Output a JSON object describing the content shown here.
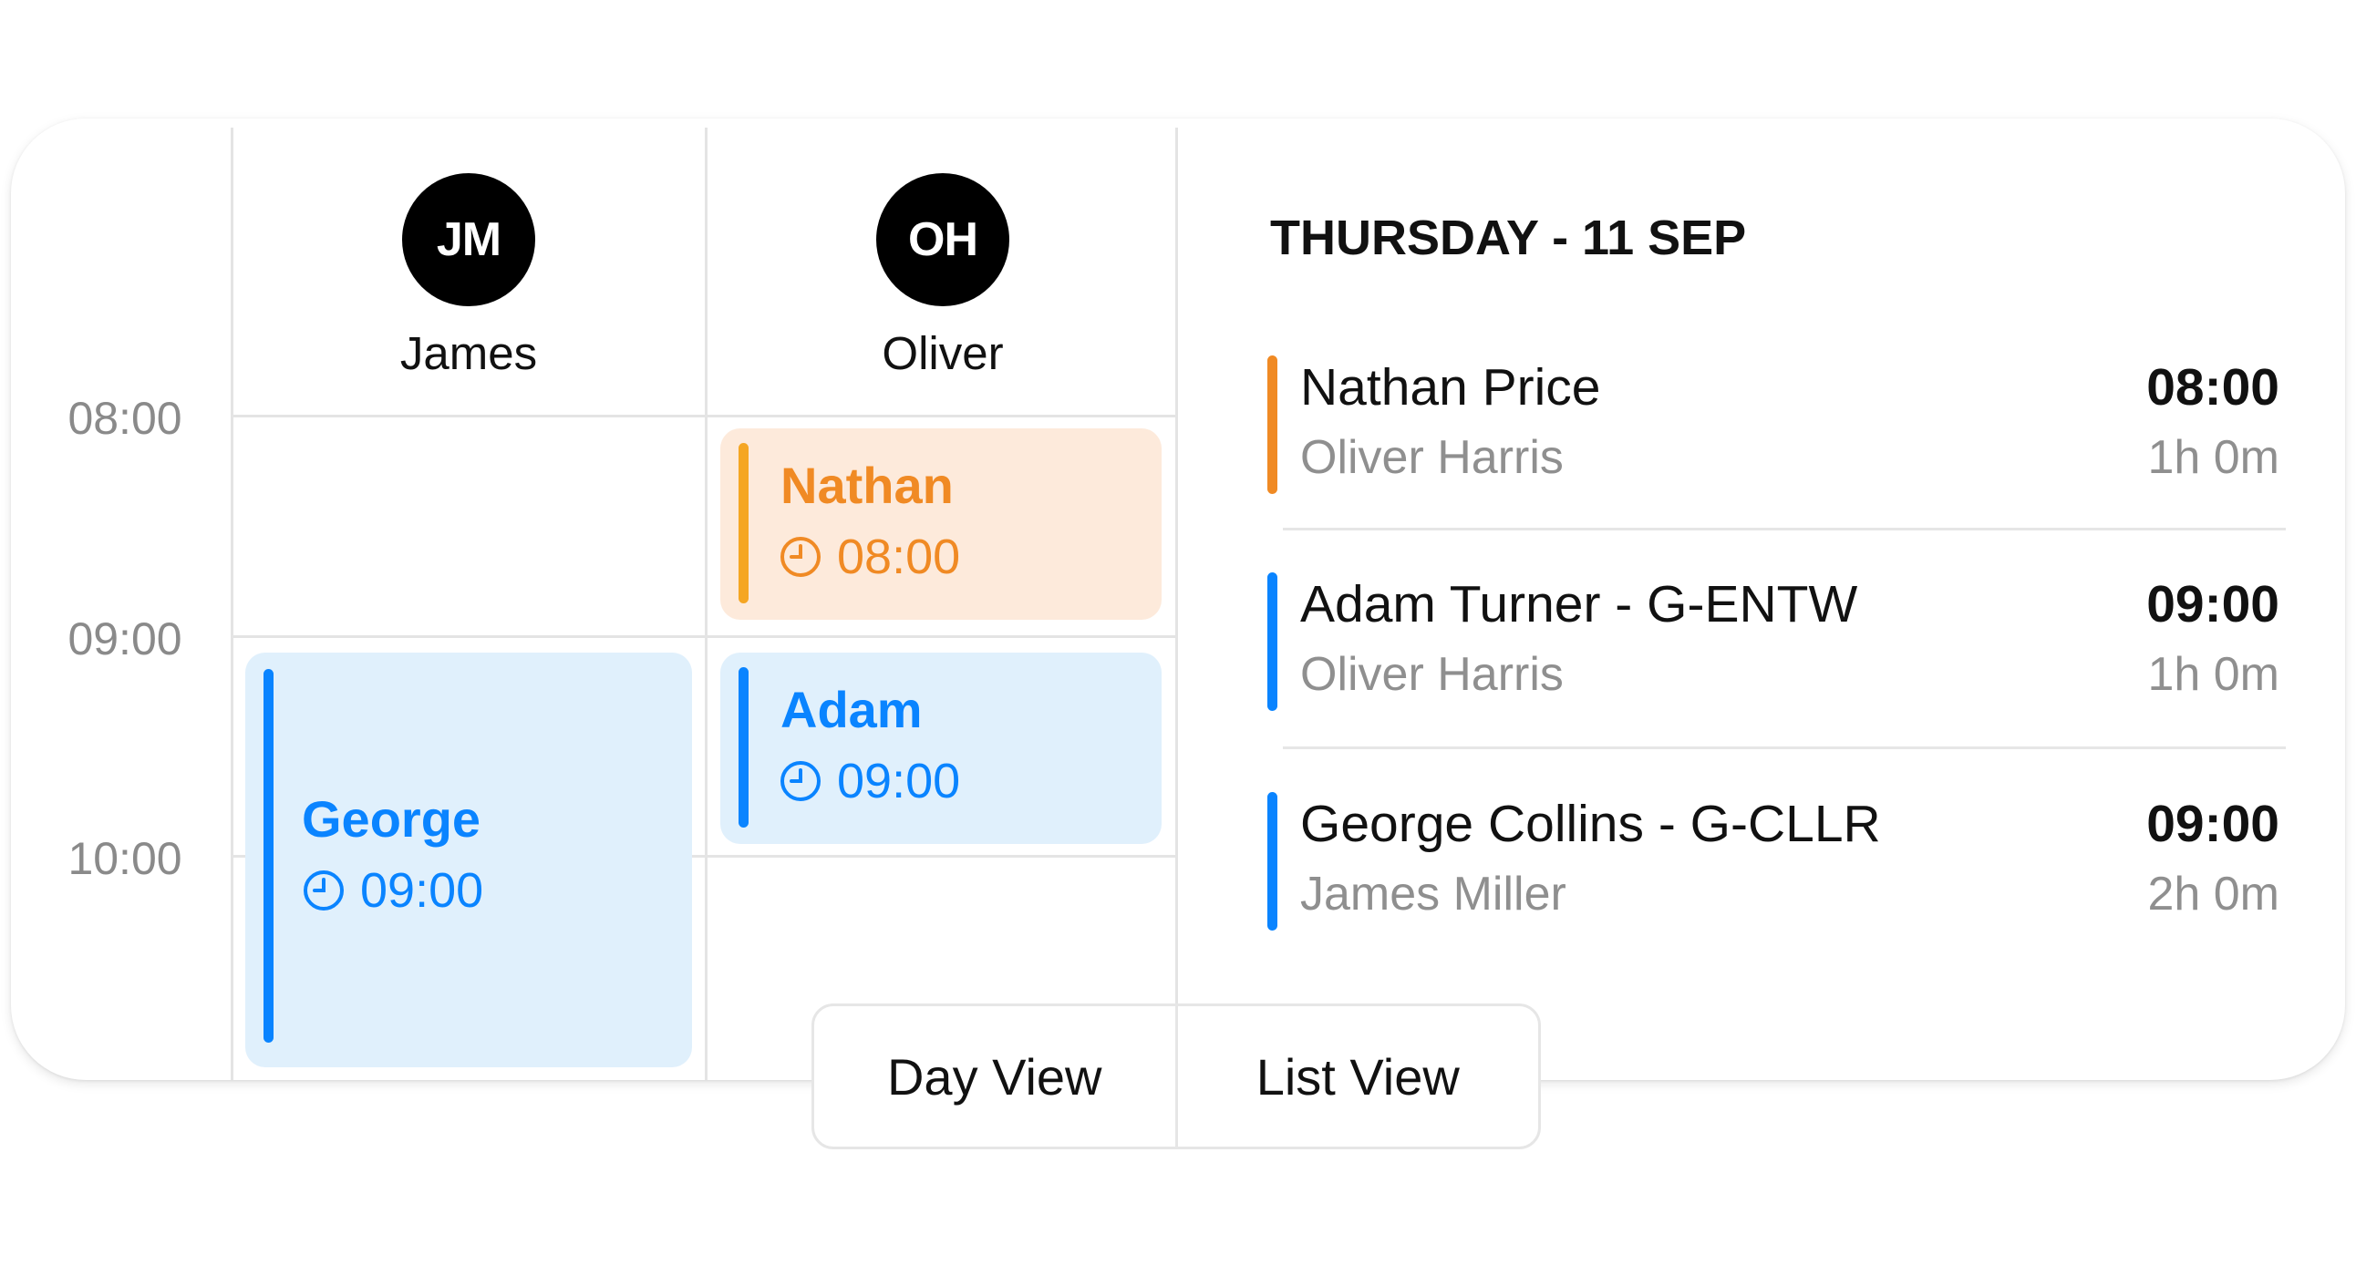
{
  "times": [
    "08:00",
    "09:00",
    "10:00"
  ],
  "staff": [
    {
      "initials": "JM",
      "name": "James"
    },
    {
      "initials": "OH",
      "name": "Oliver"
    }
  ],
  "events": [
    {
      "name": "Nathan",
      "time": "08:00",
      "theme": "orange"
    },
    {
      "name": "Adam",
      "time": "09:00",
      "theme": "blue"
    },
    {
      "name": "George",
      "time": "09:00",
      "theme": "blue"
    }
  ],
  "agenda": {
    "date": "THURSDAY - 11 SEP",
    "items": [
      {
        "title": "Nathan Price",
        "subtitle": "Oliver Harris",
        "time": "08:00",
        "duration": "1h 0m",
        "color": "#f08a24"
      },
      {
        "title": "Adam Turner - G-ENTW",
        "subtitle": "Oliver Harris",
        "time": "09:00",
        "duration": "1h 0m",
        "color": "#0a84ff"
      },
      {
        "title": "George Collins - G-CLLR",
        "subtitle": "James Miller",
        "time": "09:00",
        "duration": "2h 0m",
        "color": "#0a84ff"
      }
    ]
  },
  "view_toggle": {
    "day": "Day View",
    "list": "List View"
  },
  "colors": {
    "orange_text": "#f08a24",
    "orange_bg": "#fdeadb",
    "orange_bar": "#f5a623",
    "blue_text": "#0a84ff",
    "blue_bg": "#e0f0fc",
    "blue_bar": "#0a84ff"
  }
}
